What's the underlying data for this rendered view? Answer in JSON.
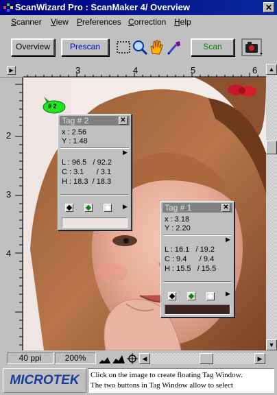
{
  "window": {
    "title": "ScanWizard Pro : ScanMaker 4/ Overview",
    "close_glyph": "✕"
  },
  "menu": [
    "Scanner",
    "View",
    "Preferences",
    "Correction",
    "Help"
  ],
  "toolbar": {
    "overview_label": "Overview",
    "prescan_label": "Prescan",
    "scan_label": "Scan",
    "tools": [
      "marquee-icon",
      "magnifier-icon",
      "hand-icon",
      "eyedropper-icon",
      "camera-icon"
    ]
  },
  "ruler": {
    "horizontal_labels": [
      "3",
      "4",
      "5",
      "6"
    ],
    "vertical_labels": [
      "2",
      "3",
      "4"
    ]
  },
  "tag_marker": "# 2",
  "tags": [
    {
      "title": "Tag # 2",
      "x": "x : 2.56",
      "y": "Y : 1.48",
      "l": "L : 96.5   / 92.2",
      "c": "C : 3.1      / 3.1",
      "h": "H : 18.3  / 18.3",
      "swatch_color": "#ebe2e2"
    },
    {
      "title": "Tag # 1",
      "x": "x : 3.18",
      "y": "Y : 2.20",
      "l": "L : 16.1   / 19.2",
      "c": "C : 9.4      / 9.4",
      "h": "H : 15.5   / 15.5",
      "swatch_color": "#3a2520"
    }
  ],
  "status": {
    "resolution": "40 ppi",
    "zoom": "200%"
  },
  "help": {
    "logo": "MICROTEK",
    "text_line1": "Click on the image to create floating Tag Window.",
    "text_line2": "The two buttons in Tag Window allow to select"
  }
}
